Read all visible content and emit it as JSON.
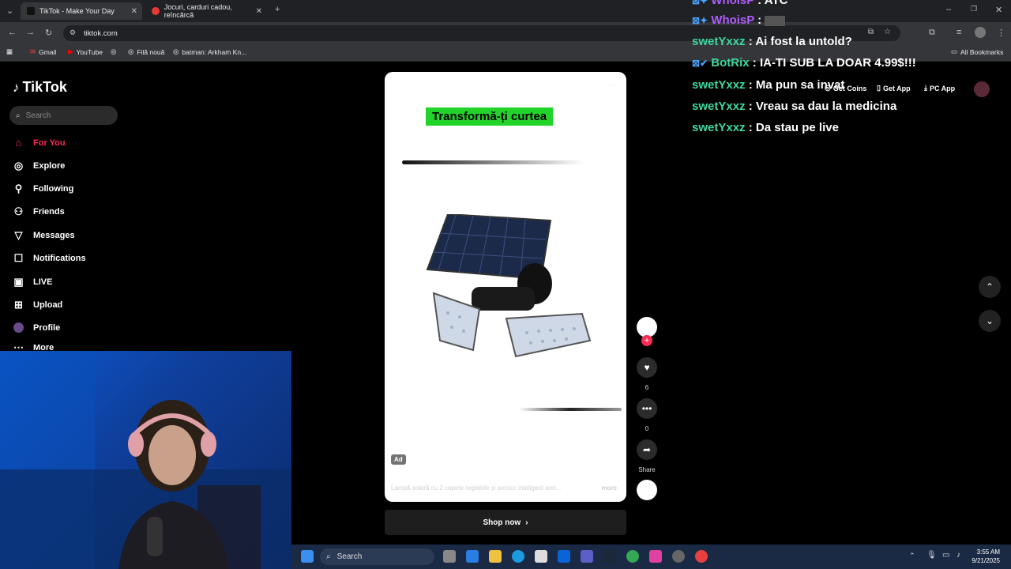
{
  "browser": {
    "tabs": [
      {
        "label": "TikTok - Make Your Day",
        "active": true
      },
      {
        "label": "Jocuri, carduri cadou, reîncărcă",
        "active": false
      }
    ],
    "url": "tiktok.com",
    "bookmarks": [
      "Gmail",
      "YouTube",
      "Filă nouă",
      "batman: Arkham Kn..."
    ],
    "all_bookmarks": "All Bookmarks"
  },
  "tiktok": {
    "logo": "TikTok",
    "search_placeholder": "Search",
    "nav": [
      {
        "label": "For You",
        "icon": "home-icon"
      },
      {
        "label": "Explore",
        "icon": "compass-icon"
      },
      {
        "label": "Following",
        "icon": "following-icon"
      },
      {
        "label": "Friends",
        "icon": "friends-icon"
      },
      {
        "label": "Messages",
        "icon": "messages-icon"
      },
      {
        "label": "Notifications",
        "icon": "notifications-icon"
      },
      {
        "label": "LIVE",
        "icon": "live-icon"
      },
      {
        "label": "Upload",
        "icon": "upload-icon"
      },
      {
        "label": "Profile",
        "icon": "profile-icon"
      },
      {
        "label": "More",
        "icon": "more-icon"
      }
    ],
    "header": {
      "get_coins": "Get Coins",
      "get_app": "Get App",
      "pc_app": "PC App"
    },
    "video": {
      "overlay_title": "Transformă-ți curtea",
      "ad_badge": "Ad",
      "caption": "Lampă solară cu 2 capete reglabile și senzor inteligent ano...",
      "more": "more",
      "shop_label": "Shop now"
    },
    "actions": {
      "likes": "6",
      "comments": "0",
      "share": "Share"
    }
  },
  "chat": [
    {
      "user": "WhoisP",
      "message": "ATC"
    },
    {
      "user": "WhoisP",
      "message": ""
    },
    {
      "user": "swetYxxz",
      "message": "Ai fost la untold?"
    },
    {
      "user": "BotRix",
      "message": "IA-TI SUB LA DOAR 4.99$!!!"
    },
    {
      "user": "swetYxxz",
      "message": "Ma pun sa invat"
    },
    {
      "user": "swetYxxz",
      "message": "Vreau sa dau la medicina"
    },
    {
      "user": "swetYxxz",
      "message": "Da stau pe live"
    }
  ],
  "taskbar": {
    "search": "Search",
    "time": "3:55 AM",
    "date": "9/21/2025"
  },
  "colors": {
    "accent": "#fe2c55",
    "chat_user": "#3dd9a0",
    "chat_user_purple": "#b05cff",
    "overlay_green": "#22d32a"
  }
}
